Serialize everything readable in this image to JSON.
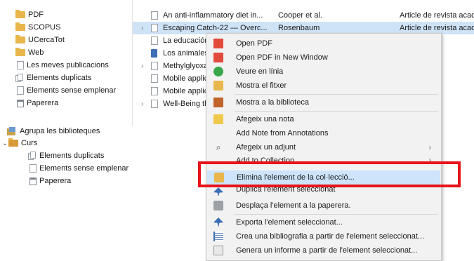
{
  "sidebar": {
    "collections": [
      {
        "label": "PDF",
        "icon": "folder-icon"
      },
      {
        "label": "SCOPUS",
        "icon": "folder-icon"
      },
      {
        "label": "UCercaTot",
        "icon": "folder-icon"
      },
      {
        "label": "Web",
        "icon": "folder-icon"
      },
      {
        "label": "Les meves publicacions",
        "icon": "document-icon"
      },
      {
        "label": "Elements duplicats",
        "icon": "duplicate-icon"
      },
      {
        "label": "Elements sense emplenar",
        "icon": "document-icon"
      },
      {
        "label": "Paperera",
        "icon": "trash-icon"
      }
    ],
    "group_libraries": "Agrupa les biblioteques",
    "curs": "Curs",
    "curs_items": [
      {
        "label": "Elements duplicats",
        "icon": "duplicate-icon"
      },
      {
        "label": "Elements sense emplenar",
        "icon": "document-icon"
      },
      {
        "label": "Paperera",
        "icon": "trash-icon"
      }
    ]
  },
  "items": [
    {
      "title": "An anti-inflammatory diet in...",
      "creator": "Cooper et al.",
      "type": "Article de revista acad",
      "selected": false,
      "expandable": false
    },
    {
      "title": "Escaping Catch-22 — Overc...",
      "creator": "Rosenbaum",
      "type": "Article de revista acad",
      "selected": true,
      "expandable": true
    },
    {
      "title": "La educación p",
      "creator": "",
      "type": "vista acad",
      "selected": false,
      "expandable": false
    },
    {
      "title": "Los animales p",
      "creator": "",
      "type": "",
      "selected": false,
      "expandable": false
    },
    {
      "title": "Methylglyoxal",
      "creator": "",
      "type": "vista acad",
      "selected": false,
      "expandable": true
    },
    {
      "title": "Mobile applica",
      "creator": "",
      "type": "vista acad",
      "selected": false,
      "expandable": false
    },
    {
      "title": "Mobile applica",
      "creator": "",
      "type": "vista acad",
      "selected": false,
      "expandable": false
    },
    {
      "title": "Well-Being thr",
      "creator": "",
      "type": "vista acad",
      "selected": false,
      "expandable": true
    }
  ],
  "menu": {
    "open_pdf": "Open PDF",
    "open_pdf_new_window": "Open PDF in New Window",
    "view_online": "Veure en línia",
    "show_file": "Mostra el fitxer",
    "show_in_library": "Mostra a la biblioteca",
    "add_note": "Afegeix una nota",
    "add_note_from_annotations": "Add Note from Annotations",
    "add_attachment": "Afegeix un adjunt",
    "add_to_collection": "Add to Collection",
    "remove_from_collection": "Elimina l'element de la col·lecció...",
    "duplicate_item": "Duplica l'element seleccionat",
    "move_to_trash": "Desplaça l'element a la paperera.",
    "export_item": "Exporta l'element seleccionat...",
    "create_bibliography": "Crea una bibliografia a partir de l'element seleccionat...",
    "generate_report": "Genera un informe a partir de l'element seleccionat..."
  },
  "colors": {
    "selection": "#cfe3f7",
    "menu_highlight": "#cde4fa",
    "annotation_box": "#e8141a",
    "folder": "#e8b64a"
  }
}
